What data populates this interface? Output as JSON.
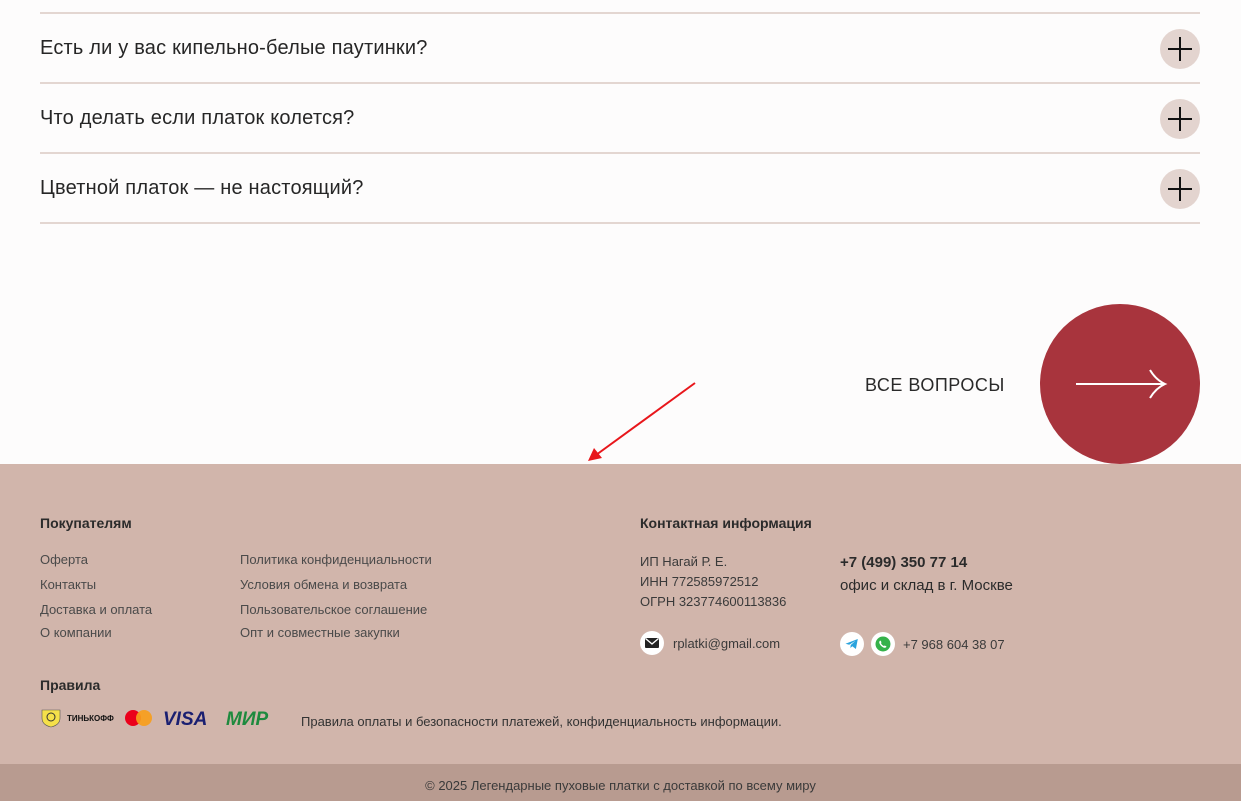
{
  "faq": {
    "items": [
      {
        "question": "Есть ли у вас кипельно-белые паутинки?"
      },
      {
        "question": "Что делать если платок колется?"
      },
      {
        "question": "Цветной платок — не настоящий?"
      }
    ],
    "all_questions_label": "ВСЕ ВОПРОСЫ"
  },
  "footer": {
    "buyers": {
      "heading": "Покупателям",
      "col1": [
        "Оферта",
        "Контакты",
        "Доставка и оплата",
        "О компании"
      ],
      "col2": [
        "Политика конфиденциальности",
        "Условия обмена и возврата",
        "Пользовательское соглашение",
        "Опт и совместные закупки"
      ]
    },
    "contacts": {
      "heading": "Контактная информация",
      "company": [
        "ИП Нагай Р. Е.",
        "ИНН 772585972512",
        "ОГРН 323774600113836"
      ],
      "phone": "+7 (499) 350 77 14",
      "office": "офис и склад в г. Москве",
      "email": "rplatki@gmail.com",
      "messenger_phone": "+7 968 604 38 07"
    },
    "rules": {
      "heading": "Правила",
      "payment_brands": [
        "ТИНЬКОФФ",
        "VISA",
        "МИР"
      ],
      "text": "Правила оплаты и безопасности платежей, конфиденциальность информации."
    },
    "copyright": "© 2025 Легендарные пуховые платки с доставкой по всему миру"
  },
  "colors": {
    "accent": "#a8343d",
    "footer_bg": "#d1b5ab",
    "bottom_bar_bg": "#b89b90",
    "annotation_arrow": "#e8161b"
  },
  "icons": [
    "plus-icon",
    "arrow-right-icon",
    "mail-icon",
    "telegram-icon",
    "whatsapp-icon"
  ]
}
